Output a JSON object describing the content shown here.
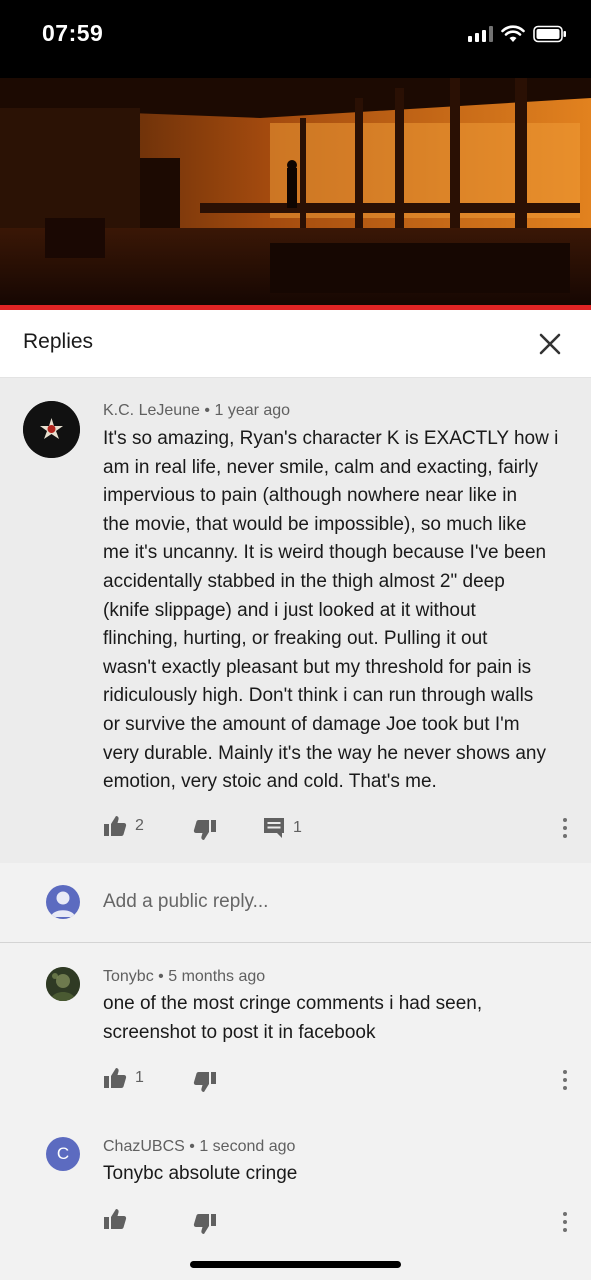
{
  "status_bar": {
    "time": "07:59",
    "icons": [
      "signal-icon",
      "wifi-icon",
      "battery-icon"
    ]
  },
  "video": {
    "progress": 1.0,
    "progress_color": "#e02424"
  },
  "replies_panel": {
    "title": "Replies",
    "close_icon": "close-icon"
  },
  "main_comment": {
    "author": "K.C. LeJeune",
    "time": "1 year ago",
    "lines": [
      "It's so amazing, Ryan's character K is EXACTLY how i",
      "am in real life, never smile, calm and exacting, fairly",
      "impervious to pain (although nowhere near like in",
      "the movie, that would be impossible), so much like",
      "me it's uncanny. It is weird though because I've been",
      "accidentally stabbed in the thigh almost 2\" deep",
      "(knife slippage) and i just looked at it without",
      "flinching, hurting, or freaking out. Pulling it out",
      "wasn't exactly pleasant but my threshold for pain is",
      "ridiculously high. Don't think i can run through walls",
      "or survive the amount of damage Joe took but I'm",
      "very durable. Mainly it's the way he never shows any",
      "emotion, very stoic and cold. That's me."
    ],
    "likes": "2",
    "replies_count": "1"
  },
  "reply_input": {
    "placeholder": "Add a public reply..."
  },
  "replies": [
    {
      "author": "Tonybc",
      "time": "5 months ago",
      "lines": [
        "one of the most cringe comments i had seen,",
        "screenshot to post it in facebook"
      ],
      "likes": "1"
    },
    {
      "author": "ChazUBCS",
      "time": "1 second ago",
      "avatar_letter": "C",
      "lines": [
        "Tonybc absolute cringe"
      ],
      "likes": ""
    }
  ],
  "separator": "•",
  "colors": {
    "accent": "#e02424",
    "avatar": "#5c6bc0",
    "highlight_bg": "#ececec"
  }
}
